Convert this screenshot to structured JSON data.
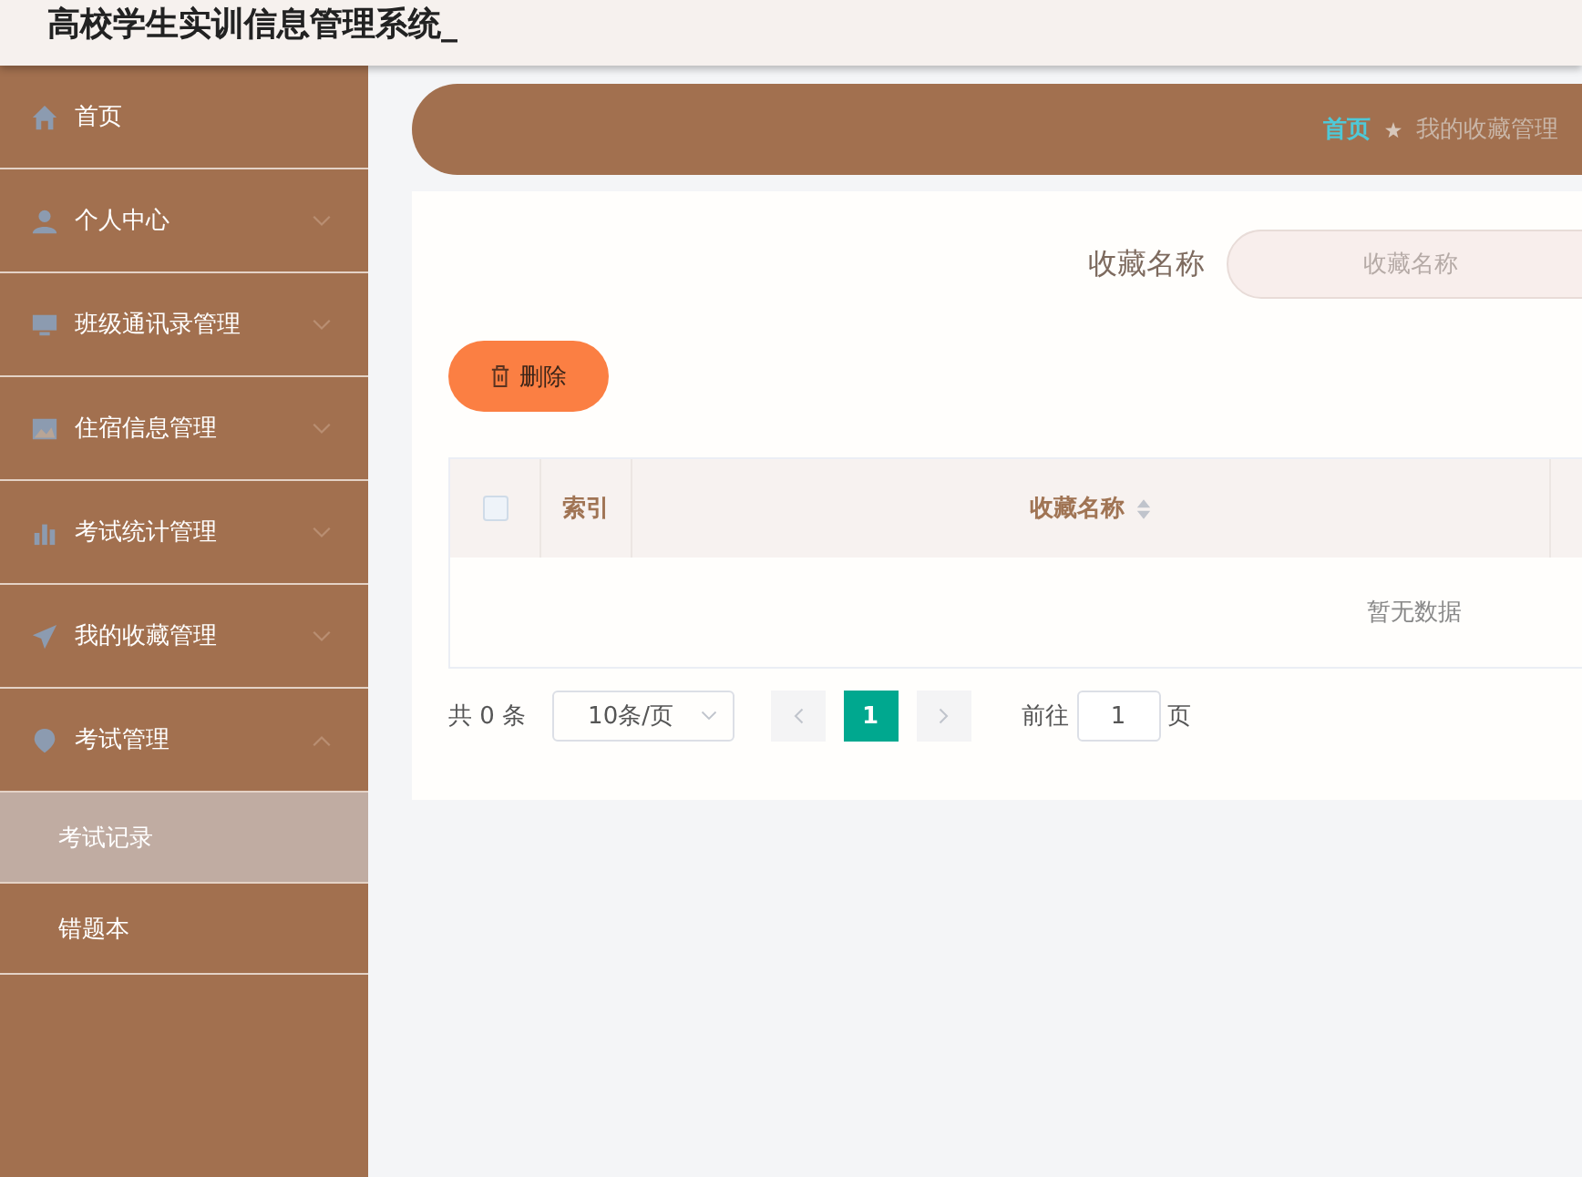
{
  "header": {
    "title": "高校学生实训信息管理系统_"
  },
  "sidebar": {
    "items": [
      {
        "label": "首页",
        "kind": "link"
      },
      {
        "label": "个人中心",
        "kind": "menu",
        "expanded": false
      },
      {
        "label": "班级通讯录管理",
        "kind": "menu",
        "expanded": false
      },
      {
        "label": "住宿信息管理",
        "kind": "menu",
        "expanded": false
      },
      {
        "label": "考试统计管理",
        "kind": "menu",
        "expanded": false
      },
      {
        "label": "我的收藏管理",
        "kind": "menu",
        "expanded": false
      },
      {
        "label": "考试管理",
        "kind": "menu",
        "expanded": true,
        "children": [
          {
            "label": "考试记录",
            "selected": true
          },
          {
            "label": "错题本",
            "selected": false
          }
        ]
      }
    ]
  },
  "breadcrumb": [
    {
      "label": "首页",
      "current": false
    },
    {
      "label": "我的收藏管理",
      "current": true
    }
  ],
  "search": {
    "label": "收藏名称",
    "placeholder": "收藏名称"
  },
  "delete_button": {
    "label": "删除"
  },
  "table": {
    "select_all": {
      "checked": false
    },
    "columns": [
      {
        "label": "索引",
        "sortable": false
      },
      {
        "label": "收藏名称",
        "sortable": true
      }
    ],
    "empty_text": "暂无数据"
  },
  "pagination": {
    "total": "共 0 条",
    "page_size": "10条/页",
    "pages": [
      {
        "label": "1",
        "selected": true
      }
    ],
    "goto_label": "前往",
    "goto_value": "1",
    "goto_suffix": "页"
  }
}
